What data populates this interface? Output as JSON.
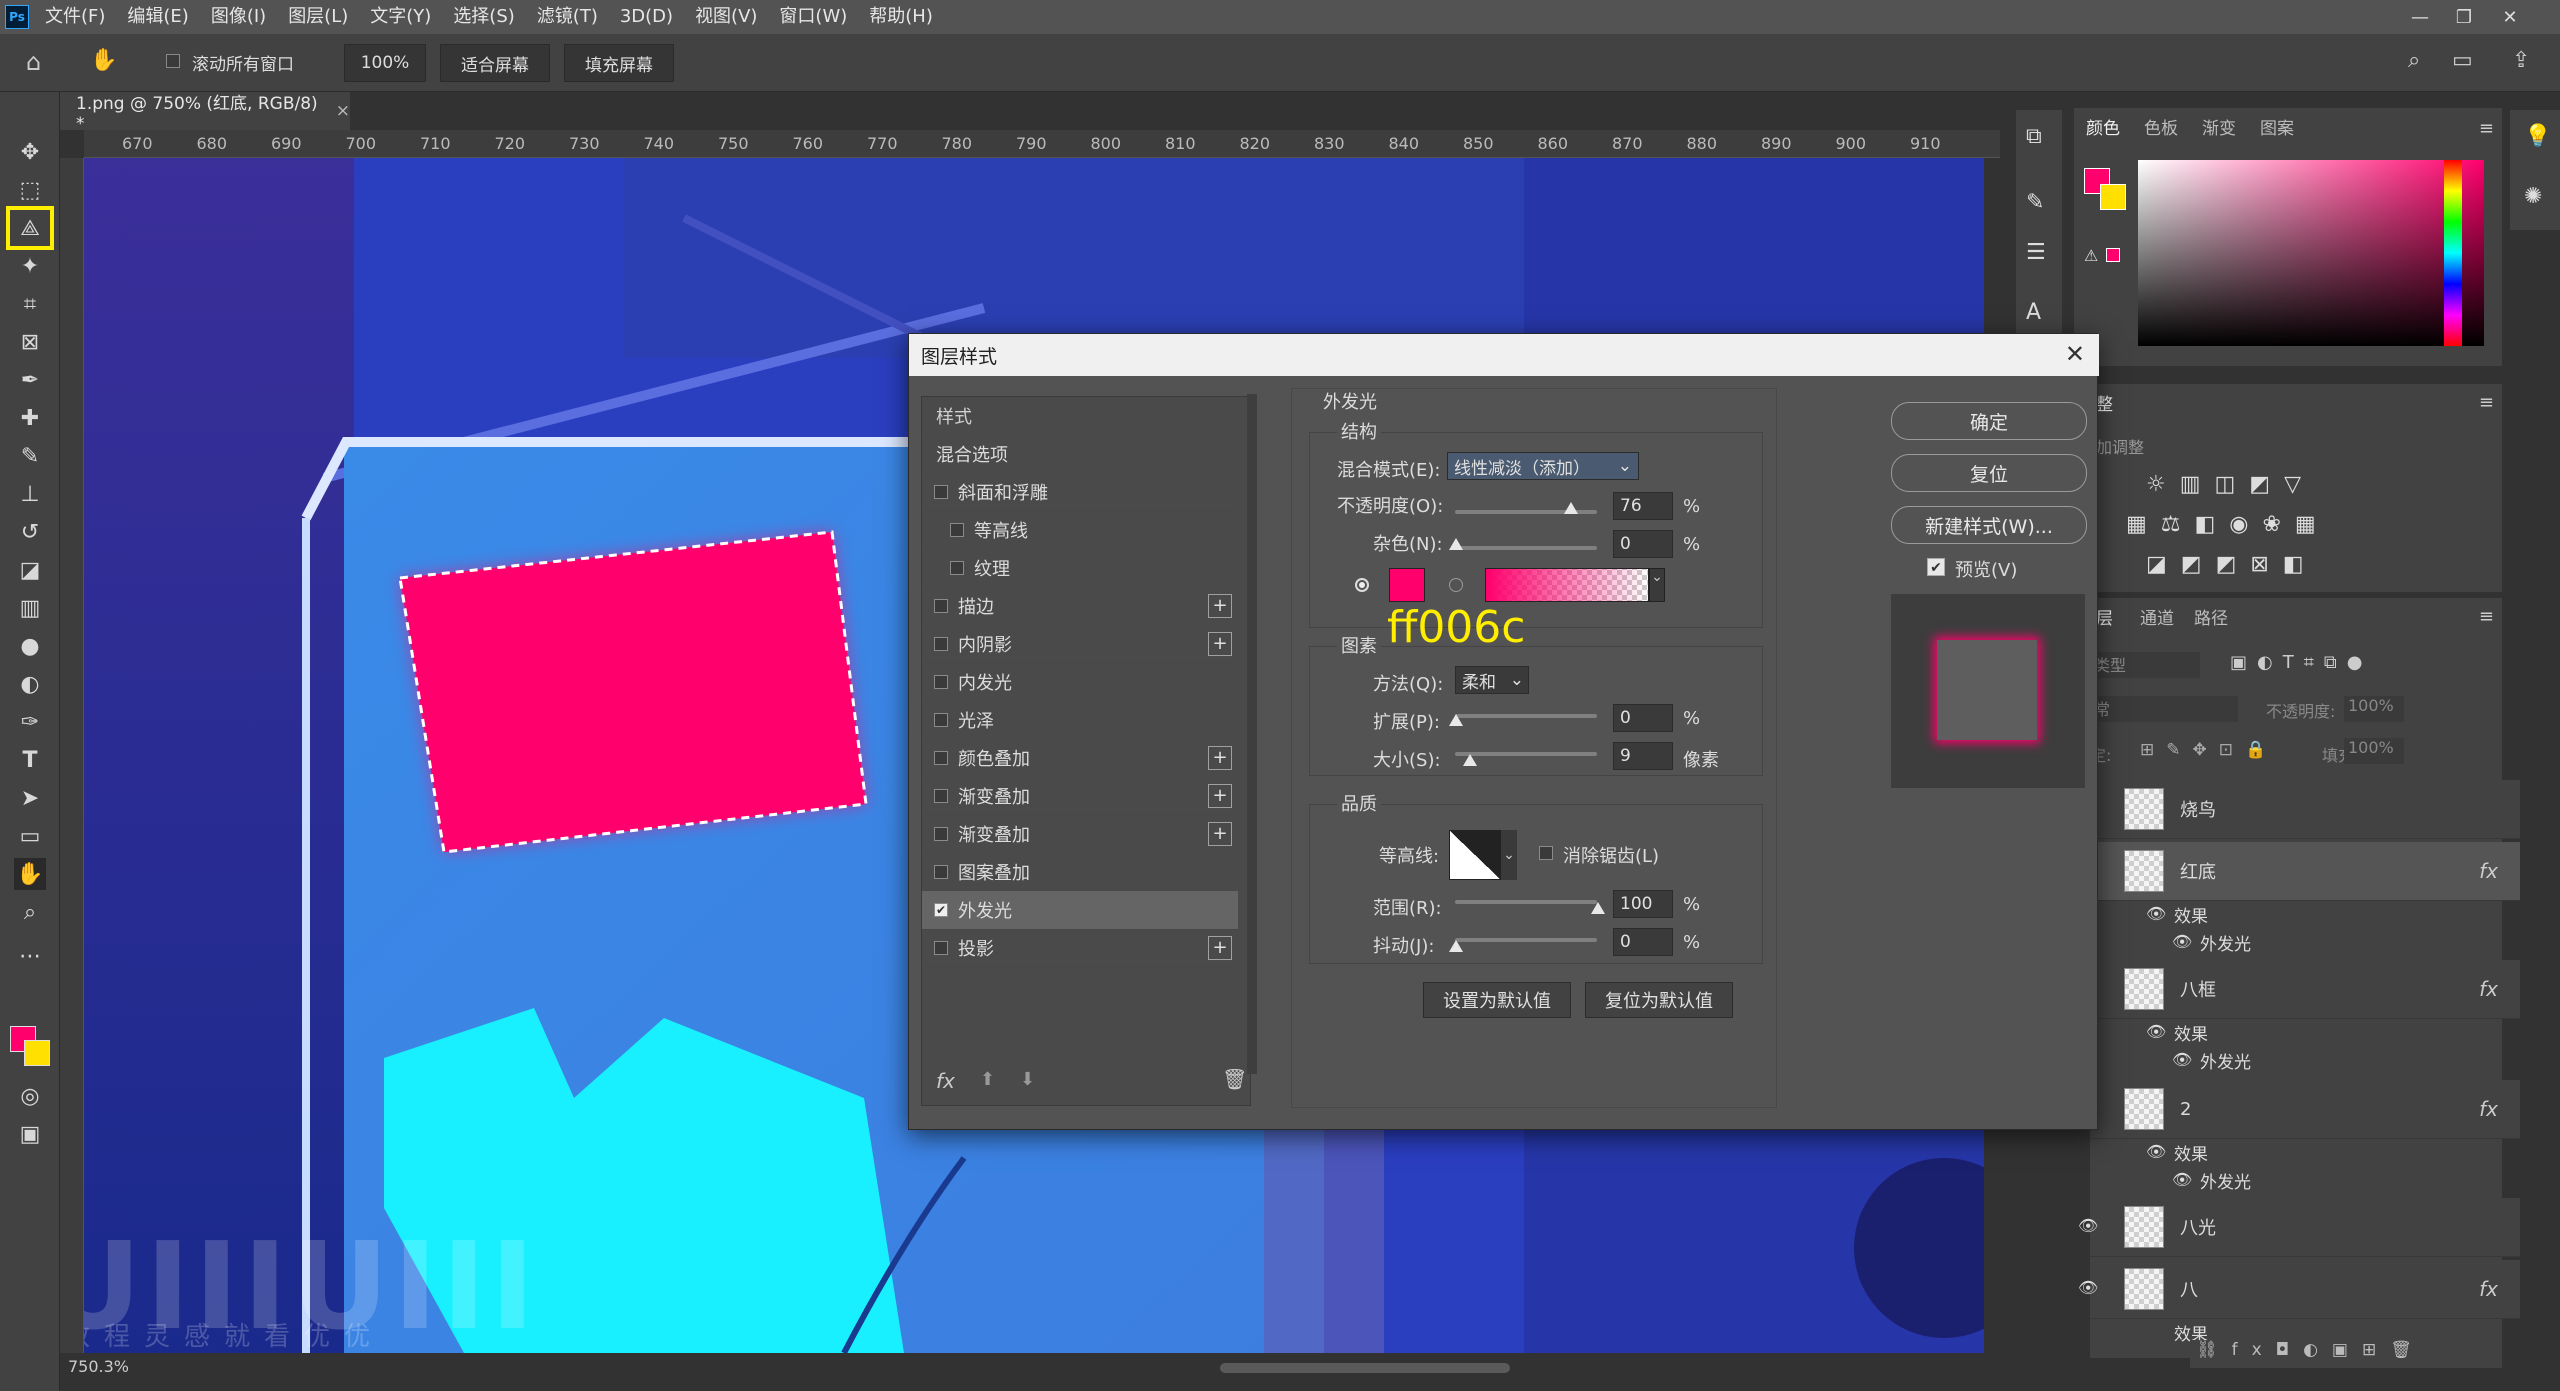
{
  "menubar": {
    "items": [
      "文件(F)",
      "编辑(E)",
      "图像(I)",
      "图层(L)",
      "文字(Y)",
      "选择(S)",
      "滤镜(T)",
      "3D(D)",
      "视图(V)",
      "窗口(W)",
      "帮助(H)"
    ]
  },
  "options_bar": {
    "scroll_all_label": "滚动所有窗口",
    "zoom_value": "100%",
    "fit_screen": "适合屏幕",
    "fill_screen": "填充屏幕"
  },
  "document": {
    "tab_title": "1.png @ 750% (红底, RGB/8) *",
    "zoom_status": "750.3%",
    "ruler_ticks": [
      "670",
      "680",
      "690",
      "700",
      "710",
      "720",
      "730",
      "740",
      "750",
      "760",
      "770",
      "780",
      "790",
      "800",
      "810",
      "820",
      "830",
      "840",
      "850",
      "860",
      "870",
      "880",
      "890",
      "900",
      "910"
    ]
  },
  "watermark": {
    "brand": "UIIIUIII",
    "slogan": "教程灵感就看优优"
  },
  "annotation": {
    "hex": "ff006c"
  },
  "colors": {
    "glow_pink": "#ff006c",
    "highlight_yellow": "#ffee00",
    "foreground": "#ff006c",
    "background": "#ffe000"
  },
  "color_panel": {
    "tabs": [
      "颜色",
      "色板",
      "渐变",
      "图案"
    ]
  },
  "adjust_panel": {
    "title": "整",
    "subtitle": "加调整"
  },
  "layers_panel": {
    "tabs": [
      "层",
      "通道",
      "路径"
    ],
    "filter_label": "类型",
    "blend_mode": "常",
    "opacity_label": "不透明度:",
    "opacity_value": "100%",
    "lock_label": "定:",
    "fill_label": "填充:",
    "fill_value": "100%",
    "layers": [
      {
        "name": "烧鸟",
        "fx": "",
        "effects_label": "",
        "effect": ""
      },
      {
        "name": "红底",
        "fx": "fx",
        "effects_label": "效果",
        "effect": "外发光"
      },
      {
        "name": "八框",
        "fx": "fx",
        "effects_label": "效果",
        "effect": "外发光"
      },
      {
        "name": "2",
        "fx": "fx",
        "effects_label": "效果",
        "effect": "外发光"
      },
      {
        "name": "八光",
        "fx": "",
        "effects_label": "",
        "effect": ""
      },
      {
        "name": "八",
        "fx": "fx",
        "effects_label": "效果",
        "effect": ""
      }
    ]
  },
  "dialog": {
    "title": "图层样式",
    "styles_header": "样式",
    "blend_options": "混合选项",
    "style_items": [
      {
        "label": "斜面和浮雕",
        "checked": false,
        "plus": false,
        "indent": false
      },
      {
        "label": "等高线",
        "checked": false,
        "plus": false,
        "indent": true
      },
      {
        "label": "纹理",
        "checked": false,
        "plus": false,
        "indent": true
      },
      {
        "label": "描边",
        "checked": false,
        "plus": true,
        "indent": false
      },
      {
        "label": "内阴影",
        "checked": false,
        "plus": true,
        "indent": false
      },
      {
        "label": "内发光",
        "checked": false,
        "plus": false,
        "indent": false
      },
      {
        "label": "光泽",
        "checked": false,
        "plus": false,
        "indent": false
      },
      {
        "label": "颜色叠加",
        "checked": false,
        "plus": true,
        "indent": false
      },
      {
        "label": "渐变叠加",
        "checked": false,
        "plus": true,
        "indent": false
      },
      {
        "label": "渐变叠加",
        "checked": false,
        "plus": true,
        "indent": false
      },
      {
        "label": "图案叠加",
        "checked": false,
        "plus": false,
        "indent": false
      },
      {
        "label": "外发光",
        "checked": true,
        "plus": false,
        "indent": false
      },
      {
        "label": "投影",
        "checked": false,
        "plus": true,
        "indent": false
      }
    ],
    "section_title": "外发光",
    "structure": {
      "title": "结构",
      "blend_mode_label": "混合模式(E):",
      "blend_mode_value": "线性减淡（添加）",
      "opacity_label": "不透明度(O):",
      "opacity_value": "76",
      "noise_label": "杂色(N):",
      "noise_value": "0",
      "percent": "%"
    },
    "elements": {
      "title": "图素",
      "technique_label": "方法(Q):",
      "technique_value": "柔和",
      "spread_label": "扩展(P):",
      "spread_value": "0",
      "size_label": "大小(S):",
      "size_value": "9",
      "px_unit": "像素",
      "percent": "%"
    },
    "quality": {
      "title": "品质",
      "contour_label": "等高线:",
      "antialias_label": "消除锯齿(L)",
      "range_label": "范围(R):",
      "range_value": "100",
      "jitter_label": "抖动(J):",
      "jitter_value": "0",
      "percent": "%"
    },
    "set_default": "设置为默认值",
    "reset_default": "复位为默认值",
    "ok": "确定",
    "reset": "复位",
    "new_style": "新建样式(W)...",
    "preview_label": "预览(V)",
    "fx_label": "fx"
  }
}
